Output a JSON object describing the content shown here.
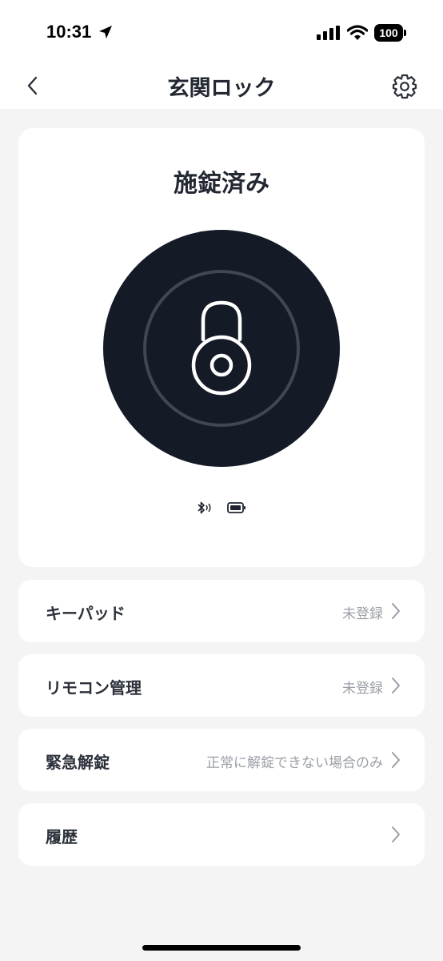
{
  "status_bar": {
    "time": "10:31",
    "battery": "100",
    "icons": [
      "location-arrow-icon",
      "signal-icon",
      "wifi-icon",
      "battery-icon"
    ]
  },
  "nav": {
    "title": "玄関ロック",
    "back_icon": "chevron-left-icon",
    "settings_icon": "gear-icon"
  },
  "lock": {
    "state": "施錠済み",
    "icon": "padlock-icon",
    "indicators": [
      "bluetooth-icon",
      "battery-icon"
    ],
    "colors": {
      "button": "#141b27",
      "ring": "#3f4654"
    }
  },
  "menu": [
    {
      "label": "キーパッド",
      "value": "未登録"
    },
    {
      "label": "リモコン管理",
      "value": "未登録"
    },
    {
      "label": "緊急解錠",
      "value": "正常に解錠できない場合のみ"
    },
    {
      "label": "履歴",
      "value": ""
    }
  ]
}
